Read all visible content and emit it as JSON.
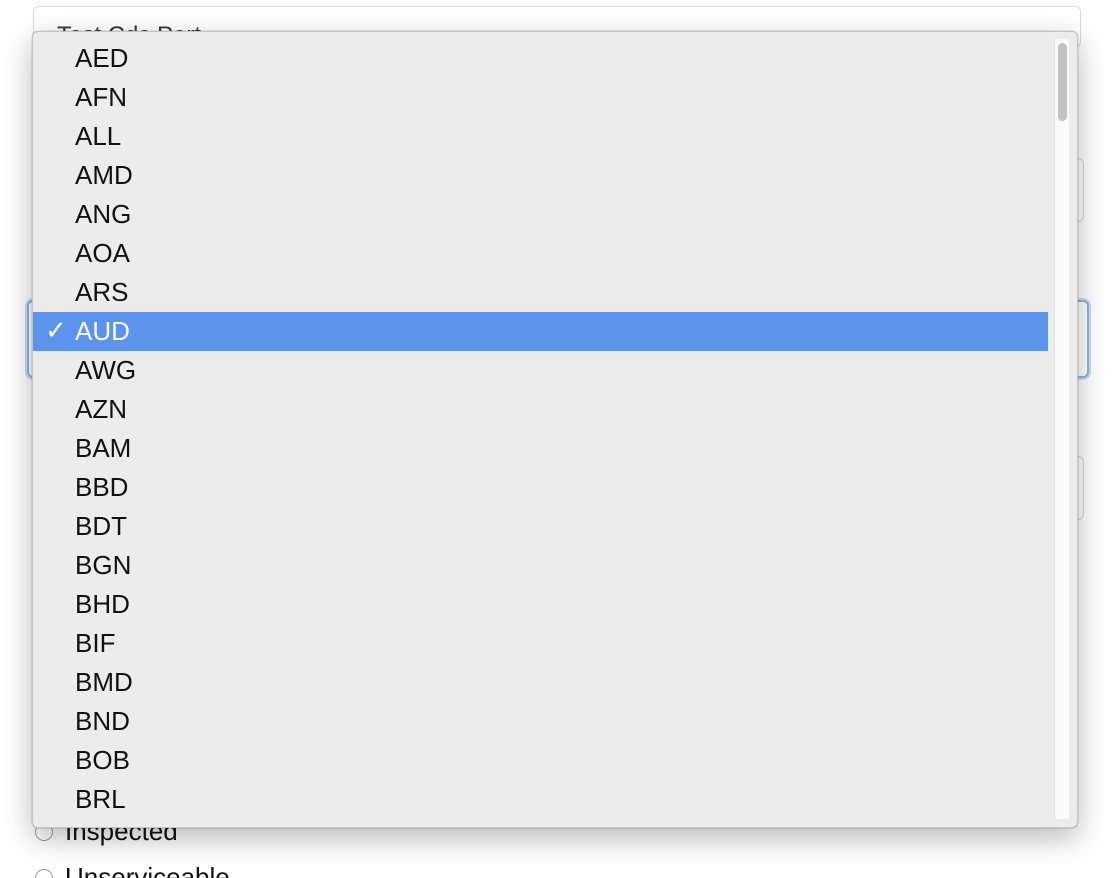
{
  "background_form": {
    "title": "Test Cds Part",
    "radio_options": [
      "Inspected",
      "Unserviceable"
    ]
  },
  "currency_dropdown": {
    "selected": "AUD",
    "options": [
      {
        "label": "AED"
      },
      {
        "label": "AFN"
      },
      {
        "label": "ALL"
      },
      {
        "label": "AMD"
      },
      {
        "label": "ANG"
      },
      {
        "label": "AOA"
      },
      {
        "label": "ARS"
      },
      {
        "label": "AUD",
        "selected": true
      },
      {
        "label": "AWG"
      },
      {
        "label": "AZN"
      },
      {
        "label": "BAM"
      },
      {
        "label": "BBD"
      },
      {
        "label": "BDT"
      },
      {
        "label": "BGN"
      },
      {
        "label": "BHD"
      },
      {
        "label": "BIF"
      },
      {
        "label": "BMD"
      },
      {
        "label": "BND"
      },
      {
        "label": "BOB"
      },
      {
        "label": "BRL"
      }
    ],
    "check_glyph": "✓",
    "scroll_position": 0.0
  },
  "colors": {
    "selected_bg": "#5c93ed",
    "popup_bg": "#ececec",
    "focus_ring": "#8ab6ea"
  }
}
